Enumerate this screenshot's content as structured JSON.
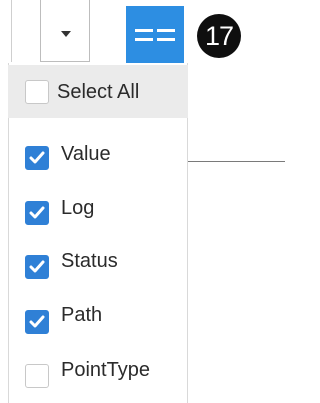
{
  "toolbar": {
    "dropdown_icon": "caret-down-icon",
    "columns_button_icon": "columns-icon",
    "columns_button_color": "#2d8ee2",
    "step_badge": "17"
  },
  "column_picker": {
    "select_all": {
      "label": "Select All",
      "checked": false
    },
    "options": [
      {
        "label": "Value",
        "checked": true
      },
      {
        "label": "Log",
        "checked": true
      },
      {
        "label": "Status",
        "checked": true
      },
      {
        "label": "Path",
        "checked": true
      },
      {
        "label": "PointType",
        "checked": false
      }
    ],
    "checkbox_checked_color": "#2f80d6"
  }
}
